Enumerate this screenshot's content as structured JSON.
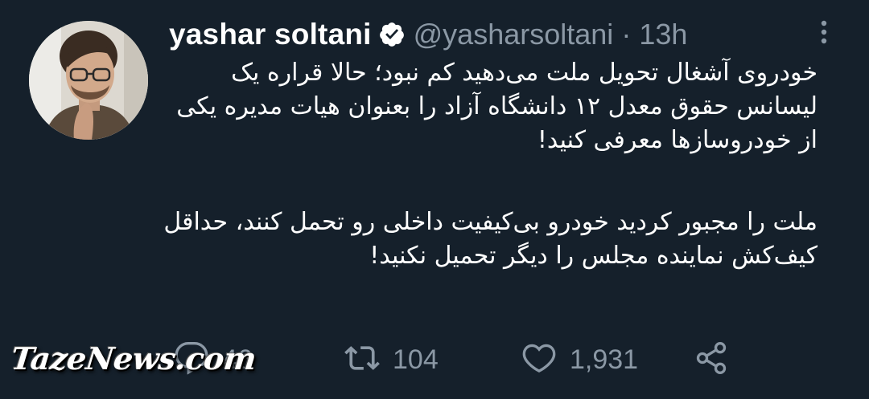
{
  "tweet": {
    "author": {
      "display_name": "yashar soltani",
      "handle": "@yasharsoltani",
      "verified": true
    },
    "separator": "·",
    "time_ago": "13h",
    "paragraphs": [
      "خودروی آشغال تحویل ملت می‌دهید کم نبود؛ حالا قراره یک لیسانس حقوق معدل ۱۲ دانشگاه آزاد را بعنوان هیات مدیره یکی از خودروسازها معرفی کنید!",
      "ملت را مجبور کردید خودرو بی‌کیفیت داخلی رو تحمل کنند، حداقل کیف‌کش نماینده مجلس را دیگر تحمیل نکنید!"
    ],
    "actions": {
      "reply_count": "46",
      "retweet_count": "104",
      "like_count": "1,931"
    }
  },
  "watermark": "TazeNews.com",
  "icons": {
    "verified": "verified-badge-icon",
    "more": "more-vertical-icon",
    "reply": "reply-icon",
    "retweet": "retweet-icon",
    "like": "heart-icon",
    "share": "share-icon"
  },
  "colors": {
    "background": "#15202b",
    "text_primary": "#ffffff",
    "text_secondary": "#8b98a5"
  }
}
